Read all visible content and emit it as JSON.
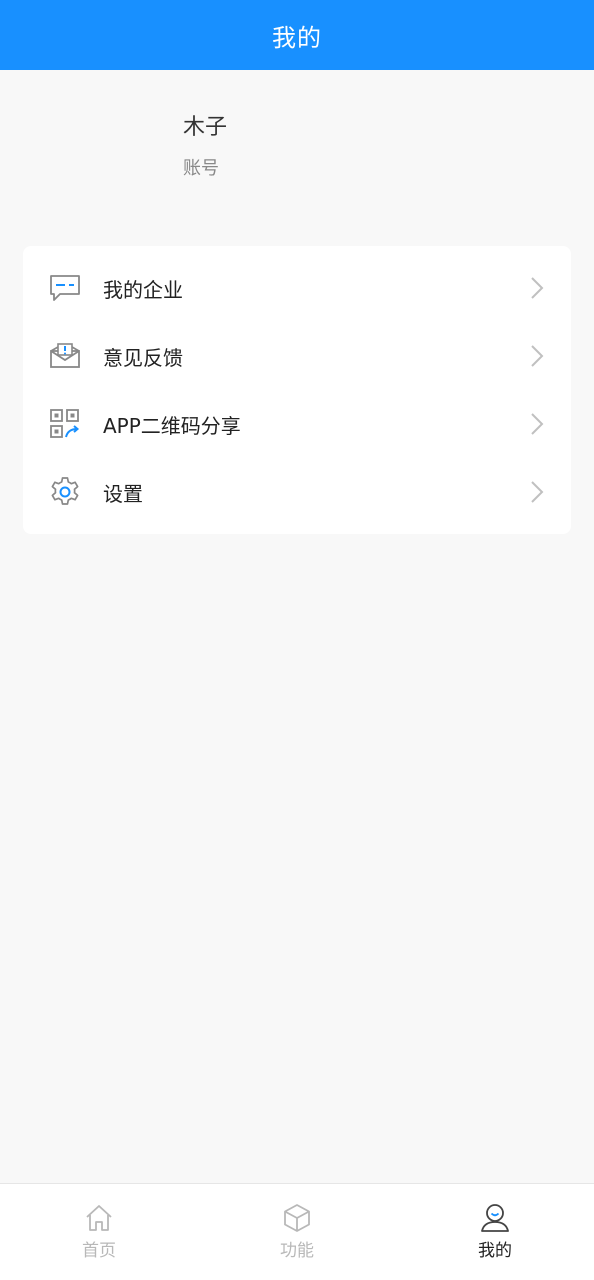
{
  "header": {
    "title": "我的"
  },
  "profile": {
    "name": "木子",
    "account_label": "账号"
  },
  "menu": {
    "items": [
      {
        "label": "我的企业",
        "icon": "message-board-icon"
      },
      {
        "label": "意见反馈",
        "icon": "feedback-mail-icon"
      },
      {
        "label": "APP二维码分享",
        "icon": "qr-share-icon"
      },
      {
        "label": "设置",
        "icon": "gear-icon"
      }
    ]
  },
  "tabbar": {
    "tabs": [
      {
        "label": "首页",
        "icon": "home-icon",
        "active": false
      },
      {
        "label": "功能",
        "icon": "cube-icon",
        "active": false
      },
      {
        "label": "我的",
        "icon": "user-icon",
        "active": true
      }
    ]
  },
  "colors": {
    "primary": "#1890ff",
    "background": "#f8f8f8",
    "icon_gray": "#888888"
  }
}
